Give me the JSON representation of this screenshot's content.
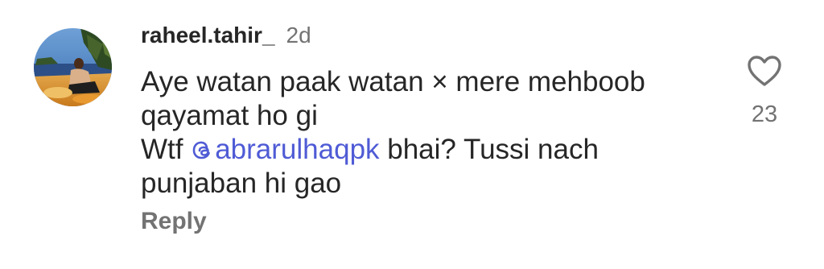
{
  "comment": {
    "username": "raheel.tahir_",
    "time_ago": "2d",
    "lines": {
      "l1": "Aye watan paak watan × mere mehboob",
      "l2": "qayamat ho gi",
      "l3_prefix": "Wtf ",
      "mention": "abrarulhaqpk",
      "l3_suffix": " bhai? Tussi nach",
      "l4": "punjaban hi gao"
    },
    "reply_label": "Reply",
    "like_count": "23",
    "icons": {
      "avatar": "profile-photo",
      "like": "heart-outline-icon",
      "mention": "threads-icon"
    },
    "colors": {
      "text": "#262626",
      "secondary": "#737373",
      "mention": "#4f5bd5"
    }
  }
}
